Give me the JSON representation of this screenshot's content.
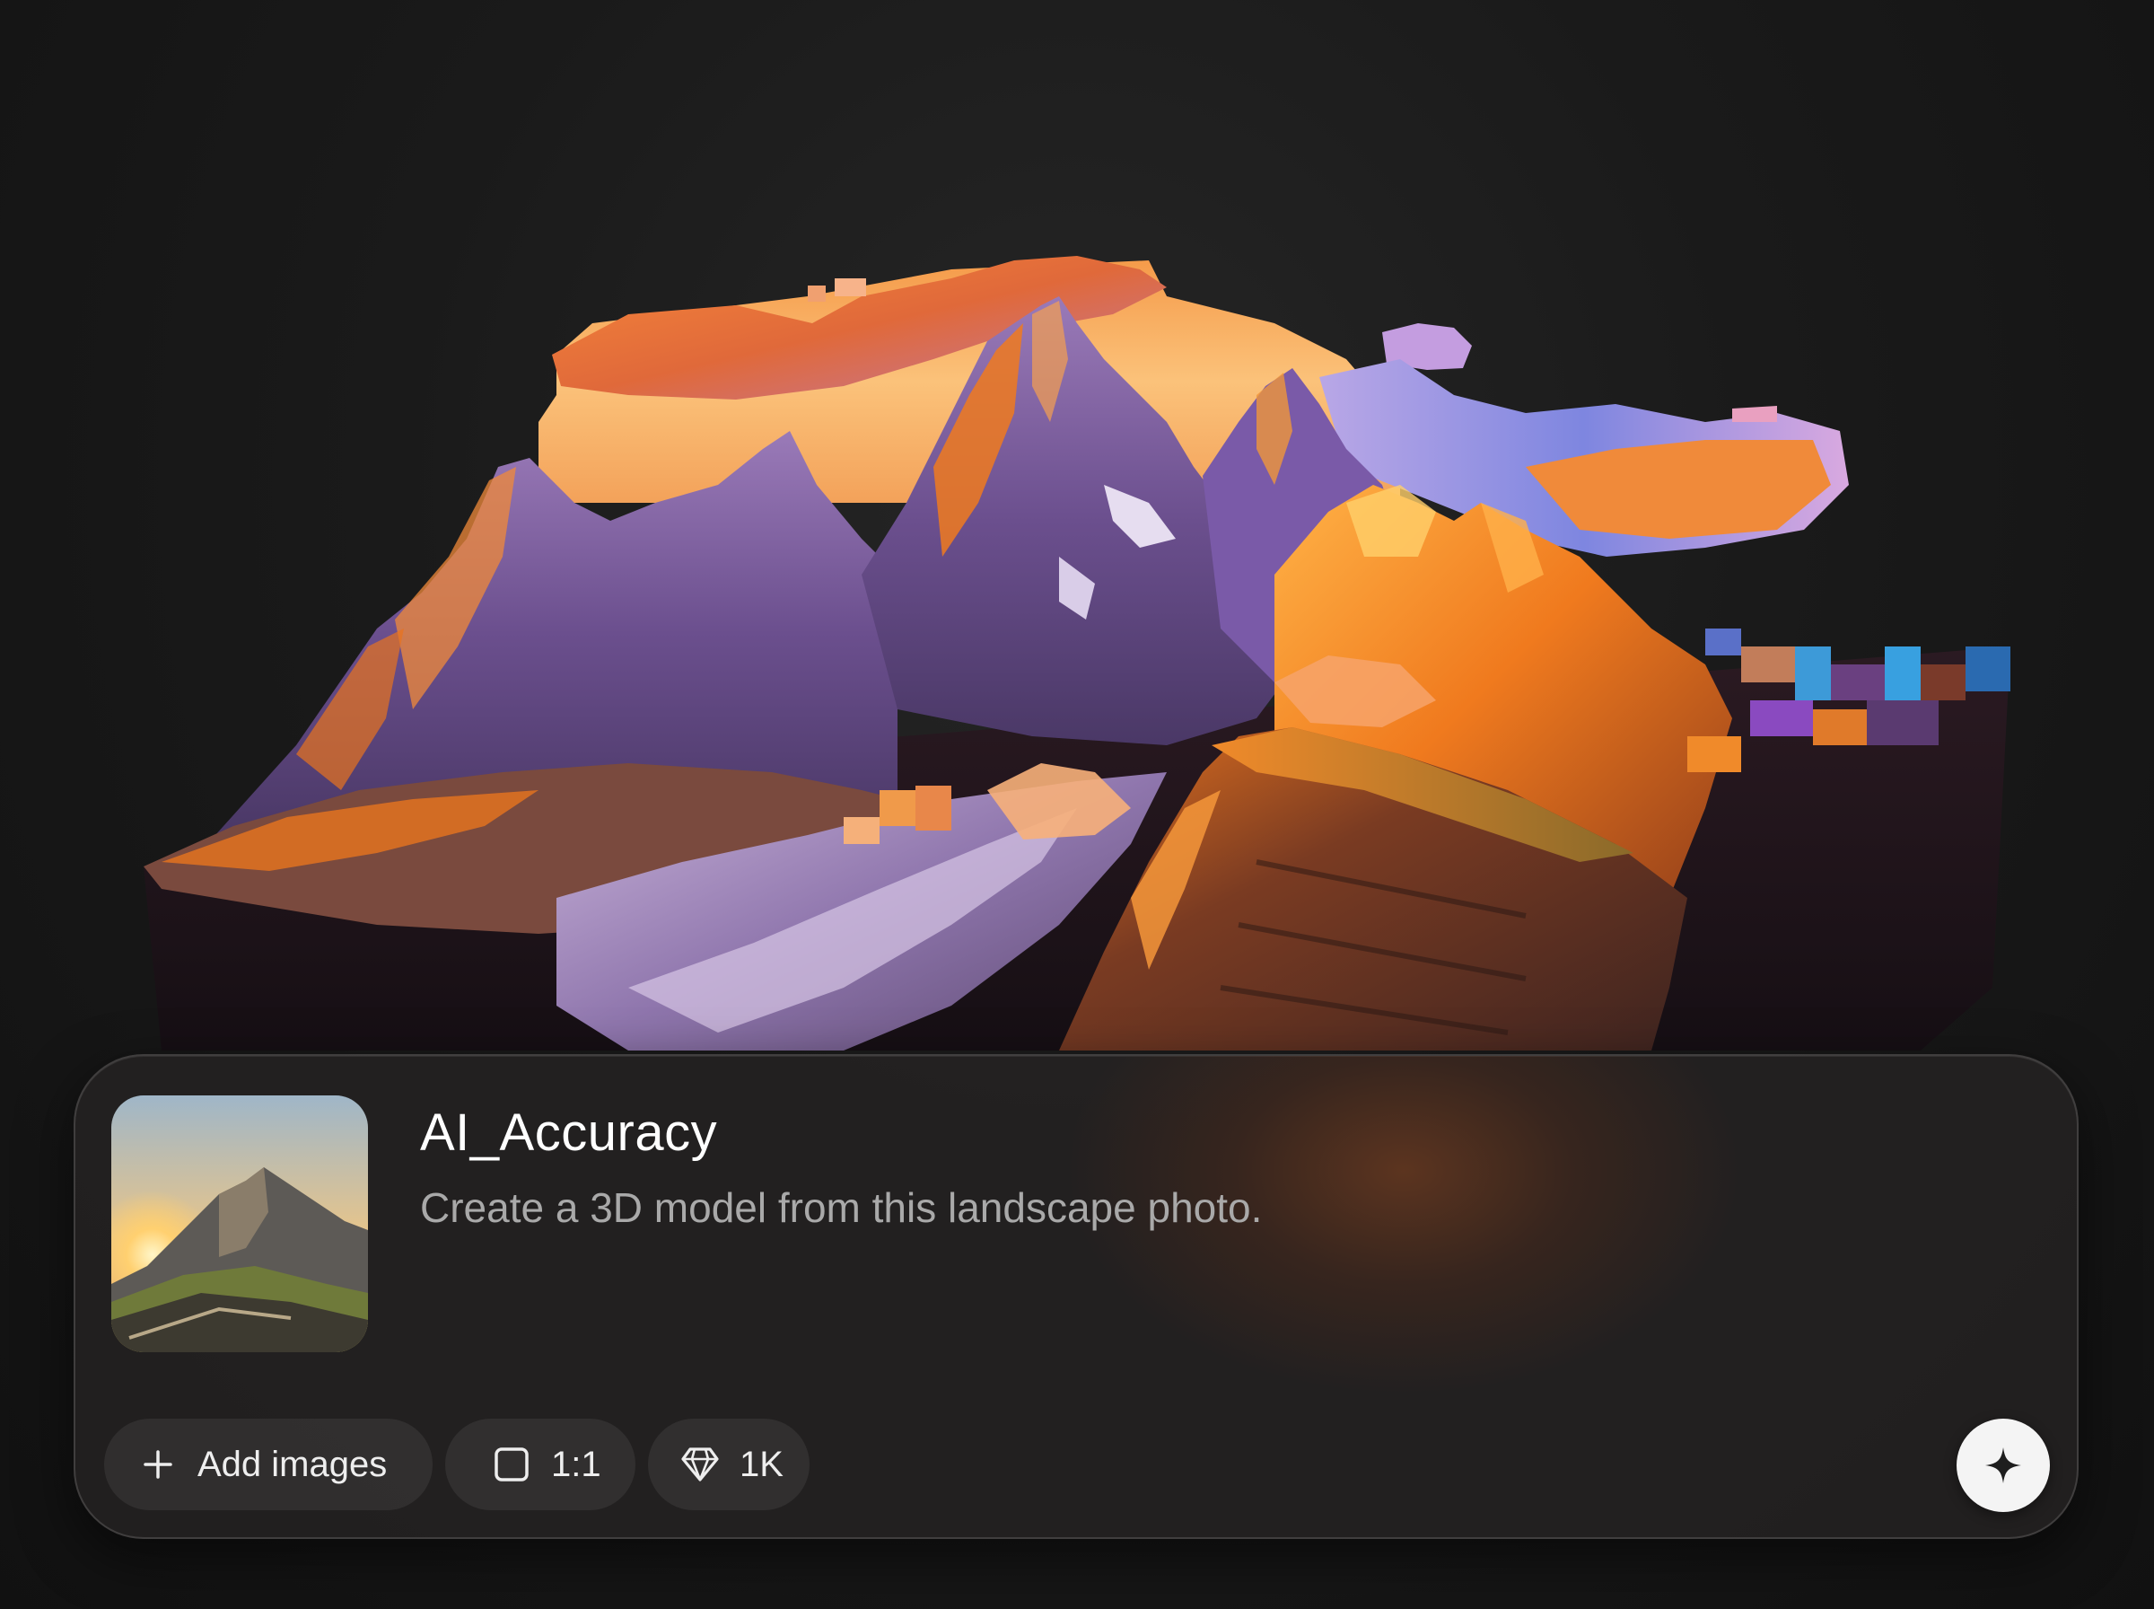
{
  "prompt": {
    "title": "AI_Accuracy",
    "description": "Create a 3D model from this landscape photo."
  },
  "toolbar": {
    "add_images_label": "Add images",
    "aspect_ratio": "1:1",
    "resolution": "1K"
  },
  "icons": {
    "add": "plus-icon",
    "aspect": "square-icon",
    "resolution": "diamond-icon",
    "generate": "sparkle-icon"
  },
  "colors": {
    "background": "#141414",
    "panel": "#242222",
    "accent_orange": "#f07a1e",
    "accent_purple": "#7a5aa8",
    "generate_button": "#f4f4f4"
  }
}
